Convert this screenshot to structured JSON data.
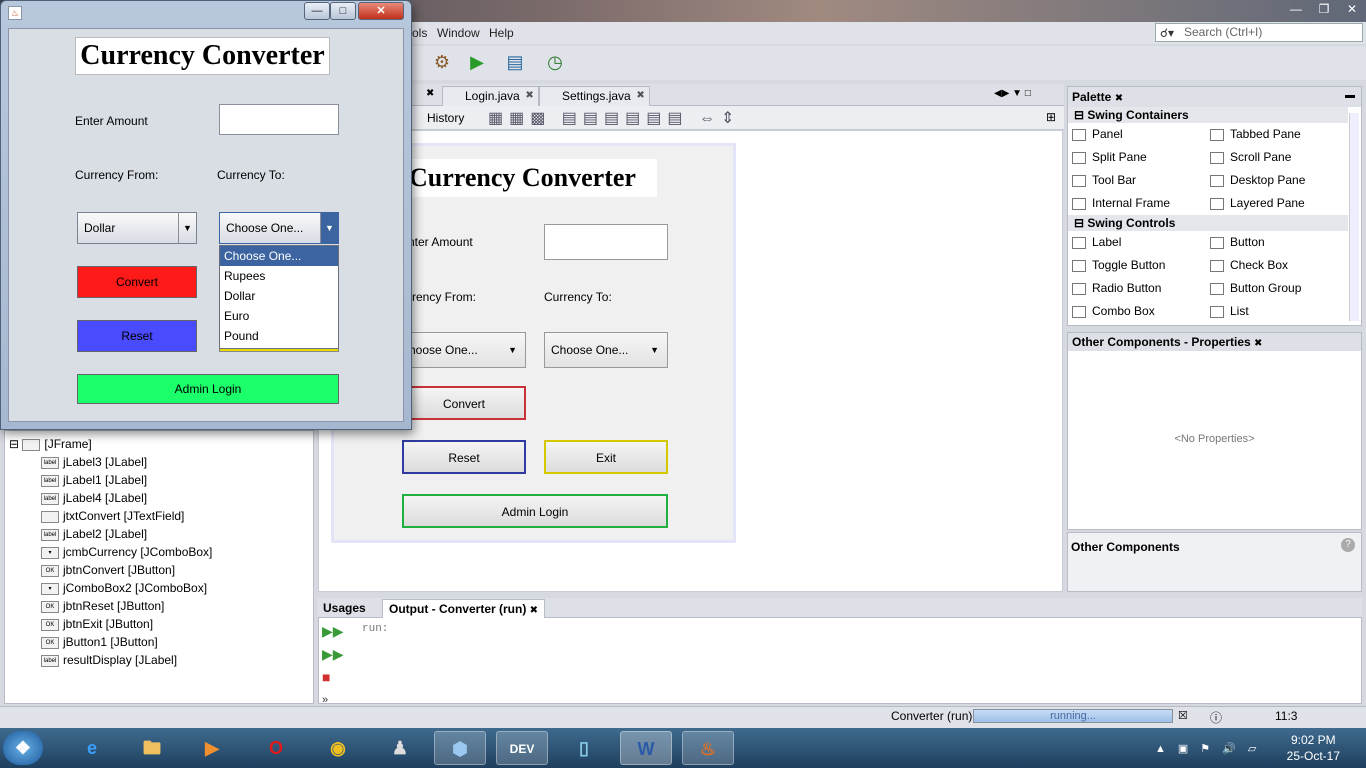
{
  "ide": {
    "menus": [
      "ols",
      "Window",
      "Help"
    ],
    "search_placeholder": "Search (Ctrl+I)",
    "editor_tabs": [
      "Login.java",
      "Settings.java"
    ],
    "design_tab": "History",
    "preview": {
      "title": "Currency Converter",
      "amount_label": "nter Amount",
      "from_label": "rrency From:",
      "to_label": "Currency To:",
      "from_combo": "hoose One...",
      "to_combo": "Choose One...",
      "convert": "Convert",
      "reset": "Reset",
      "exit": "Exit",
      "admin_login": "Admin Login"
    },
    "navigator": {
      "root": "[JFrame]",
      "items": [
        {
          "icon": "label",
          "text": "jLabel3 [JLabel]"
        },
        {
          "icon": "label",
          "text": "jLabel1 [JLabel]"
        },
        {
          "icon": "label",
          "text": "jLabel4 [JLabel]"
        },
        {
          "icon": "field",
          "text": "jtxtConvert [JTextField]"
        },
        {
          "icon": "label",
          "text": "jLabel2 [JLabel]"
        },
        {
          "icon": "combo",
          "text": "jcmbCurrency [JComboBox]"
        },
        {
          "icon": "OK",
          "text": "jbtnConvert [JButton]"
        },
        {
          "icon": "combo",
          "text": "jComboBox2 [JComboBox]"
        },
        {
          "icon": "OK",
          "text": "jbtnReset [JButton]"
        },
        {
          "icon": "OK",
          "text": "jbtnExit [JButton]"
        },
        {
          "icon": "OK",
          "text": "jButton1 [JButton]"
        },
        {
          "icon": "label",
          "text": "resultDisplay [JLabel]"
        }
      ]
    },
    "palette": {
      "title": "Palette",
      "sections": [
        {
          "name": "Swing Containers",
          "items": [
            "Panel",
            "Tabbed Pane",
            "Split Pane",
            "Scroll Pane",
            "Tool Bar",
            "Desktop Pane",
            "Internal Frame",
            "Layered Pane"
          ]
        },
        {
          "name": "Swing Controls",
          "items": [
            "Label",
            "Button",
            "Toggle Button",
            "Check Box",
            "Radio Button",
            "Button Group",
            "Combo Box",
            "List"
          ]
        }
      ]
    },
    "properties": {
      "title": "Other Components - Properties",
      "empty": "<No Properties>",
      "footer": "Other Components"
    },
    "output": {
      "tabs": [
        "Usages",
        "Output - Converter (run)"
      ],
      "text": "run:"
    },
    "status": {
      "task": "Converter (run)",
      "progress_text": "running...",
      "progress": 1.0,
      "position": "11:3"
    }
  },
  "app": {
    "title": "Currency Converter",
    "amount_label": "Enter Amount",
    "amount_value": "",
    "from_label": "Currency From:",
    "to_label": "Currency To:",
    "from_value": "Dollar",
    "to_value": "Choose One...",
    "dropdown_options": [
      "Choose One...",
      "Rupees",
      "Dollar",
      "Euro",
      "Pound"
    ],
    "convert": "Convert",
    "reset": "Reset",
    "admin_login": "Admin Login",
    "colors": {
      "convert": "#ff1a1a",
      "reset": "#4a4aff",
      "admin": "#1aff6a",
      "exit_border": "#e6d800"
    }
  },
  "taskbar": {
    "apps": [
      "start-orb",
      "internet-explorer",
      "file-explorer",
      "media-player",
      "opera",
      "chrome",
      "counter-strike",
      "virtualbox",
      "dev-cpp",
      "notepad",
      "word",
      "java"
    ],
    "time": "9:02 PM",
    "date": "25-Oct-17"
  }
}
